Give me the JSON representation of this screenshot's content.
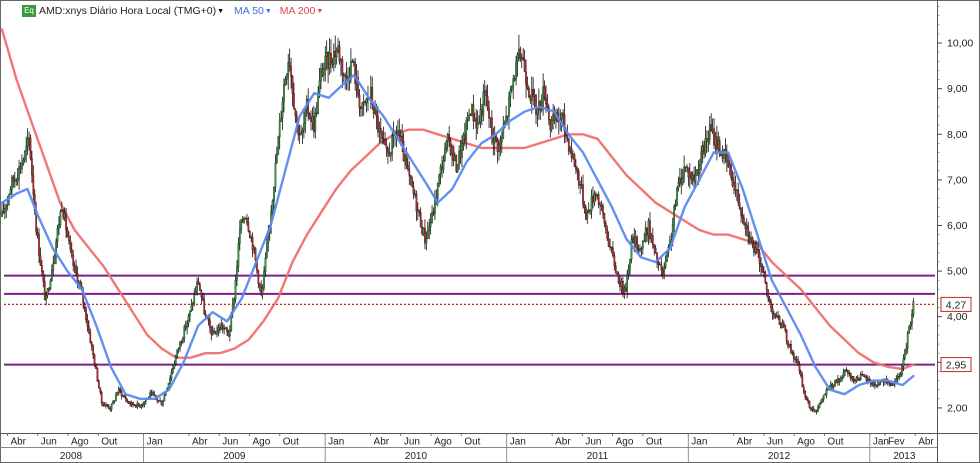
{
  "legend": {
    "symbol_icon": "Eq",
    "title": "AMD:xnys Diário Hora Local (TMG+0)",
    "ma50_label": "MA 50",
    "ma200_label": "MA 200",
    "dropdown_icon": "caret-down-icon"
  },
  "chart_data": {
    "type": "candlestick",
    "ylim": [
      1.45,
      10.9
    ],
    "y_ticks": [
      2,
      3,
      4,
      5,
      6,
      7,
      8,
      9,
      10
    ],
    "y_tick_labels": [
      "2,00",
      "3,00",
      "4,00",
      "5,00",
      "6,00",
      "7,00",
      "8,00",
      "9,00",
      "10,00"
    ],
    "x_range": [
      2008.22,
      2013.37
    ],
    "months": [
      {
        "label": "Abr",
        "t": 2008.25
      },
      {
        "label": "Jun",
        "t": 2008.4167
      },
      {
        "label": "Ago",
        "t": 2008.5833
      },
      {
        "label": "Out",
        "t": 2008.75
      },
      {
        "label": "Jan",
        "t": 2009.0
      },
      {
        "label": "Abr",
        "t": 2009.25
      },
      {
        "label": "Jun",
        "t": 2009.4167
      },
      {
        "label": "Ago",
        "t": 2009.5833
      },
      {
        "label": "Out",
        "t": 2009.75
      },
      {
        "label": "Jan",
        "t": 2010.0
      },
      {
        "label": "Abr",
        "t": 2010.25
      },
      {
        "label": "Jun",
        "t": 2010.4167
      },
      {
        "label": "Ago",
        "t": 2010.5833
      },
      {
        "label": "Out",
        "t": 2010.75
      },
      {
        "label": "Jan",
        "t": 2011.0
      },
      {
        "label": "Abr",
        "t": 2011.25
      },
      {
        "label": "Jun",
        "t": 2011.4167
      },
      {
        "label": "Ago",
        "t": 2011.5833
      },
      {
        "label": "Out",
        "t": 2011.75
      },
      {
        "label": "Jan",
        "t": 2012.0
      },
      {
        "label": "Abr",
        "t": 2012.25
      },
      {
        "label": "Jun",
        "t": 2012.4167
      },
      {
        "label": "Ago",
        "t": 2012.5833
      },
      {
        "label": "Out",
        "t": 2012.75
      },
      {
        "label": "Jan",
        "t": 2013.0
      },
      {
        "label": "Fev",
        "t": 2013.0833
      },
      {
        "label": "Abr",
        "t": 2013.25
      }
    ],
    "years": [
      {
        "label": "2008",
        "t": 2008.6
      },
      {
        "label": "2009",
        "t": 2009.5
      },
      {
        "label": "2010",
        "t": 2010.5
      },
      {
        "label": "2011",
        "t": 2011.5
      },
      {
        "label": "2012",
        "t": 2012.5
      },
      {
        "label": "2013",
        "t": 2013.19
      }
    ],
    "year_boundaries": [
      2009.0,
      2010.0,
      2011.0,
      2012.0,
      2013.0
    ],
    "price_path": [
      [
        2008.22,
        6.2
      ],
      [
        2008.27,
        6.9
      ],
      [
        2008.31,
        7.2
      ],
      [
        2008.35,
        7.6
      ],
      [
        2008.37,
        7.9
      ],
      [
        2008.41,
        5.9
      ],
      [
        2008.46,
        4.3
      ],
      [
        2008.5,
        5.2
      ],
      [
        2008.55,
        6.5
      ],
      [
        2008.6,
        5.3
      ],
      [
        2008.66,
        4.5
      ],
      [
        2008.72,
        3.2
      ],
      [
        2008.77,
        2.1
      ],
      [
        2008.82,
        2.0
      ],
      [
        2008.86,
        2.4
      ],
      [
        2008.92,
        2.1
      ],
      [
        2008.98,
        2.05
      ],
      [
        2009.04,
        2.3
      ],
      [
        2009.1,
        2.1
      ],
      [
        2009.14,
        2.6
      ],
      [
        2009.19,
        3.3
      ],
      [
        2009.25,
        4.0
      ],
      [
        2009.3,
        4.8
      ],
      [
        2009.34,
        4.0
      ],
      [
        2009.38,
        3.6
      ],
      [
        2009.43,
        3.8
      ],
      [
        2009.47,
        3.6
      ],
      [
        2009.5,
        4.5
      ],
      [
        2009.53,
        5.9
      ],
      [
        2009.56,
        6.3
      ],
      [
        2009.6,
        5.6
      ],
      [
        2009.65,
        4.4
      ],
      [
        2009.7,
        6.3
      ],
      [
        2009.74,
        7.8
      ],
      [
        2009.77,
        9.0
      ],
      [
        2009.8,
        9.8
      ],
      [
        2009.84,
        8.3
      ],
      [
        2009.87,
        7.9
      ],
      [
        2009.9,
        8.6
      ],
      [
        2009.94,
        8.2
      ],
      [
        2009.98,
        9.4
      ],
      [
        2010.03,
        9.7
      ],
      [
        2010.07,
        9.9
      ],
      [
        2010.11,
        9.2
      ],
      [
        2010.15,
        9.6
      ],
      [
        2010.2,
        8.5
      ],
      [
        2010.25,
        8.9
      ],
      [
        2010.3,
        8.0
      ],
      [
        2010.34,
        7.5
      ],
      [
        2010.4,
        8.1
      ],
      [
        2010.45,
        7.2
      ],
      [
        2010.5,
        6.5
      ],
      [
        2010.55,
        5.7
      ],
      [
        2010.59,
        6.2
      ],
      [
        2010.64,
        7.3
      ],
      [
        2010.68,
        7.9
      ],
      [
        2010.72,
        7.3
      ],
      [
        2010.76,
        7.8
      ],
      [
        2010.8,
        8.6
      ],
      [
        2010.84,
        8.2
      ],
      [
        2010.88,
        8.9
      ],
      [
        2010.92,
        8.0
      ],
      [
        2010.96,
        7.7
      ],
      [
        2011.0,
        8.4
      ],
      [
        2011.04,
        9.3
      ],
      [
        2011.08,
        9.8
      ],
      [
        2011.13,
        8.9
      ],
      [
        2011.17,
        8.5
      ],
      [
        2011.21,
        9.0
      ],
      [
        2011.24,
        8.2
      ],
      [
        2011.3,
        8.4
      ],
      [
        2011.35,
        7.7
      ],
      [
        2011.4,
        7.0
      ],
      [
        2011.44,
        6.2
      ],
      [
        2011.49,
        6.8
      ],
      [
        2011.53,
        6.2
      ],
      [
        2011.57,
        5.5
      ],
      [
        2011.61,
        4.9
      ],
      [
        2011.65,
        4.5
      ],
      [
        2011.69,
        5.7
      ],
      [
        2011.74,
        5.5
      ],
      [
        2011.78,
        6.0
      ],
      [
        2011.82,
        5.3
      ],
      [
        2011.86,
        4.9
      ],
      [
        2011.9,
        5.6
      ],
      [
        2011.94,
        6.8
      ],
      [
        2011.98,
        7.3
      ],
      [
        2012.03,
        7.0
      ],
      [
        2012.08,
        7.6
      ],
      [
        2012.12,
        8.1
      ],
      [
        2012.16,
        7.8
      ],
      [
        2012.2,
        7.5
      ],
      [
        2012.24,
        7.1
      ],
      [
        2012.28,
        6.5
      ],
      [
        2012.32,
        6.0
      ],
      [
        2012.36,
        5.5
      ],
      [
        2012.4,
        5.2
      ],
      [
        2012.44,
        4.4
      ],
      [
        2012.48,
        4.0
      ],
      [
        2012.52,
        3.8
      ],
      [
        2012.56,
        3.3
      ],
      [
        2012.6,
        3.0
      ],
      [
        2012.64,
        2.3
      ],
      [
        2012.67,
        2.0
      ],
      [
        2012.71,
        1.95
      ],
      [
        2012.75,
        2.3
      ],
      [
        2012.79,
        2.5
      ],
      [
        2012.83,
        2.6
      ],
      [
        2012.87,
        2.8
      ],
      [
        2012.91,
        2.6
      ],
      [
        2012.95,
        2.7
      ],
      [
        2012.99,
        2.6
      ],
      [
        2013.03,
        2.5
      ],
      [
        2013.07,
        2.6
      ],
      [
        2013.11,
        2.5
      ],
      [
        2013.15,
        2.6
      ],
      [
        2013.18,
        2.9
      ],
      [
        2013.21,
        3.6
      ],
      [
        2013.24,
        4.27
      ]
    ],
    "series": [
      {
        "name": "MA 50",
        "color": "#5b8af0",
        "points": [
          [
            2008.22,
            6.5
          ],
          [
            2008.3,
            6.7
          ],
          [
            2008.36,
            6.8
          ],
          [
            2008.42,
            6.2
          ],
          [
            2008.5,
            5.5
          ],
          [
            2008.58,
            5.0
          ],
          [
            2008.66,
            4.6
          ],
          [
            2008.74,
            3.8
          ],
          [
            2008.82,
            2.9
          ],
          [
            2008.9,
            2.3
          ],
          [
            2008.98,
            2.2
          ],
          [
            2009.06,
            2.2
          ],
          [
            2009.14,
            2.4
          ],
          [
            2009.22,
            3.0
          ],
          [
            2009.3,
            3.8
          ],
          [
            2009.38,
            4.1
          ],
          [
            2009.46,
            3.9
          ],
          [
            2009.54,
            4.4
          ],
          [
            2009.62,
            5.2
          ],
          [
            2009.7,
            6.0
          ],
          [
            2009.78,
            7.2
          ],
          [
            2009.86,
            8.4
          ],
          [
            2009.94,
            8.9
          ],
          [
            2010.02,
            8.8
          ],
          [
            2010.1,
            9.1
          ],
          [
            2010.16,
            9.3
          ],
          [
            2010.24,
            8.8
          ],
          [
            2010.32,
            8.4
          ],
          [
            2010.4,
            7.9
          ],
          [
            2010.48,
            7.4
          ],
          [
            2010.56,
            6.9
          ],
          [
            2010.62,
            6.5
          ],
          [
            2010.7,
            6.8
          ],
          [
            2010.78,
            7.4
          ],
          [
            2010.86,
            7.8
          ],
          [
            2010.94,
            8.0
          ],
          [
            2011.02,
            8.3
          ],
          [
            2011.1,
            8.5
          ],
          [
            2011.18,
            8.6
          ],
          [
            2011.26,
            8.5
          ],
          [
            2011.34,
            8.0
          ],
          [
            2011.42,
            7.6
          ],
          [
            2011.5,
            7.0
          ],
          [
            2011.58,
            6.4
          ],
          [
            2011.66,
            5.7
          ],
          [
            2011.74,
            5.3
          ],
          [
            2011.82,
            5.2
          ],
          [
            2011.9,
            5.5
          ],
          [
            2011.98,
            6.4
          ],
          [
            2012.06,
            7.0
          ],
          [
            2012.14,
            7.6
          ],
          [
            2012.22,
            7.6
          ],
          [
            2012.3,
            6.8
          ],
          [
            2012.38,
            5.8
          ],
          [
            2012.46,
            4.8
          ],
          [
            2012.54,
            4.2
          ],
          [
            2012.62,
            3.6
          ],
          [
            2012.7,
            2.9
          ],
          [
            2012.78,
            2.4
          ],
          [
            2012.86,
            2.3
          ],
          [
            2012.94,
            2.5
          ],
          [
            2013.02,
            2.6
          ],
          [
            2013.1,
            2.6
          ],
          [
            2013.18,
            2.5
          ],
          [
            2013.24,
            2.7
          ]
        ]
      },
      {
        "name": "MA 200",
        "color": "#f07070",
        "points": [
          [
            2008.22,
            10.3
          ],
          [
            2008.3,
            9.2
          ],
          [
            2008.38,
            8.3
          ],
          [
            2008.46,
            7.4
          ],
          [
            2008.54,
            6.5
          ],
          [
            2008.62,
            5.9
          ],
          [
            2008.7,
            5.5
          ],
          [
            2008.78,
            5.1
          ],
          [
            2008.86,
            4.6
          ],
          [
            2008.94,
            4.1
          ],
          [
            2009.02,
            3.6
          ],
          [
            2009.1,
            3.3
          ],
          [
            2009.18,
            3.1
          ],
          [
            2009.26,
            3.1
          ],
          [
            2009.34,
            3.2
          ],
          [
            2009.42,
            3.2
          ],
          [
            2009.5,
            3.3
          ],
          [
            2009.58,
            3.5
          ],
          [
            2009.66,
            3.9
          ],
          [
            2009.74,
            4.4
          ],
          [
            2009.82,
            5.2
          ],
          [
            2009.9,
            5.8
          ],
          [
            2009.98,
            6.3
          ],
          [
            2010.06,
            6.8
          ],
          [
            2010.14,
            7.2
          ],
          [
            2010.22,
            7.5
          ],
          [
            2010.3,
            7.8
          ],
          [
            2010.38,
            8.0
          ],
          [
            2010.46,
            8.1
          ],
          [
            2010.54,
            8.1
          ],
          [
            2010.62,
            8.0
          ],
          [
            2010.7,
            7.9
          ],
          [
            2010.78,
            7.8
          ],
          [
            2010.86,
            7.7
          ],
          [
            2010.94,
            7.7
          ],
          [
            2011.02,
            7.7
          ],
          [
            2011.1,
            7.7
          ],
          [
            2011.18,
            7.8
          ],
          [
            2011.26,
            7.9
          ],
          [
            2011.34,
            8.0
          ],
          [
            2011.42,
            8.0
          ],
          [
            2011.5,
            7.9
          ],
          [
            2011.58,
            7.5
          ],
          [
            2011.66,
            7.1
          ],
          [
            2011.74,
            6.8
          ],
          [
            2011.82,
            6.5
          ],
          [
            2011.9,
            6.3
          ],
          [
            2011.98,
            6.1
          ],
          [
            2012.06,
            5.9
          ],
          [
            2012.14,
            5.8
          ],
          [
            2012.22,
            5.8
          ],
          [
            2012.3,
            5.7
          ],
          [
            2012.38,
            5.6
          ],
          [
            2012.46,
            5.2
          ],
          [
            2012.54,
            4.9
          ],
          [
            2012.62,
            4.6
          ],
          [
            2012.7,
            4.2
          ],
          [
            2012.78,
            3.8
          ],
          [
            2012.86,
            3.5
          ],
          [
            2012.94,
            3.2
          ],
          [
            2013.02,
            3.0
          ],
          [
            2013.1,
            2.9
          ],
          [
            2013.18,
            2.85
          ],
          [
            2013.24,
            2.95
          ]
        ]
      }
    ],
    "horizontal_lines": [
      {
        "y": 4.9,
        "color": "#7a1f8a",
        "style": "solid"
      },
      {
        "y": 4.5,
        "color": "#7a1f8a",
        "style": "solid"
      },
      {
        "y": 2.95,
        "color": "#7a1f8a",
        "style": "solid"
      },
      {
        "y": 4.27,
        "color": "#c0281e",
        "style": "dotted"
      }
    ],
    "price_labels": [
      {
        "text": "4,27",
        "y": 4.27,
        "color": "#c0281e"
      },
      {
        "text": "2,95",
        "y": 2.95,
        "color": "#c0281e"
      }
    ],
    "grid": false,
    "legend_position": "top-left"
  }
}
